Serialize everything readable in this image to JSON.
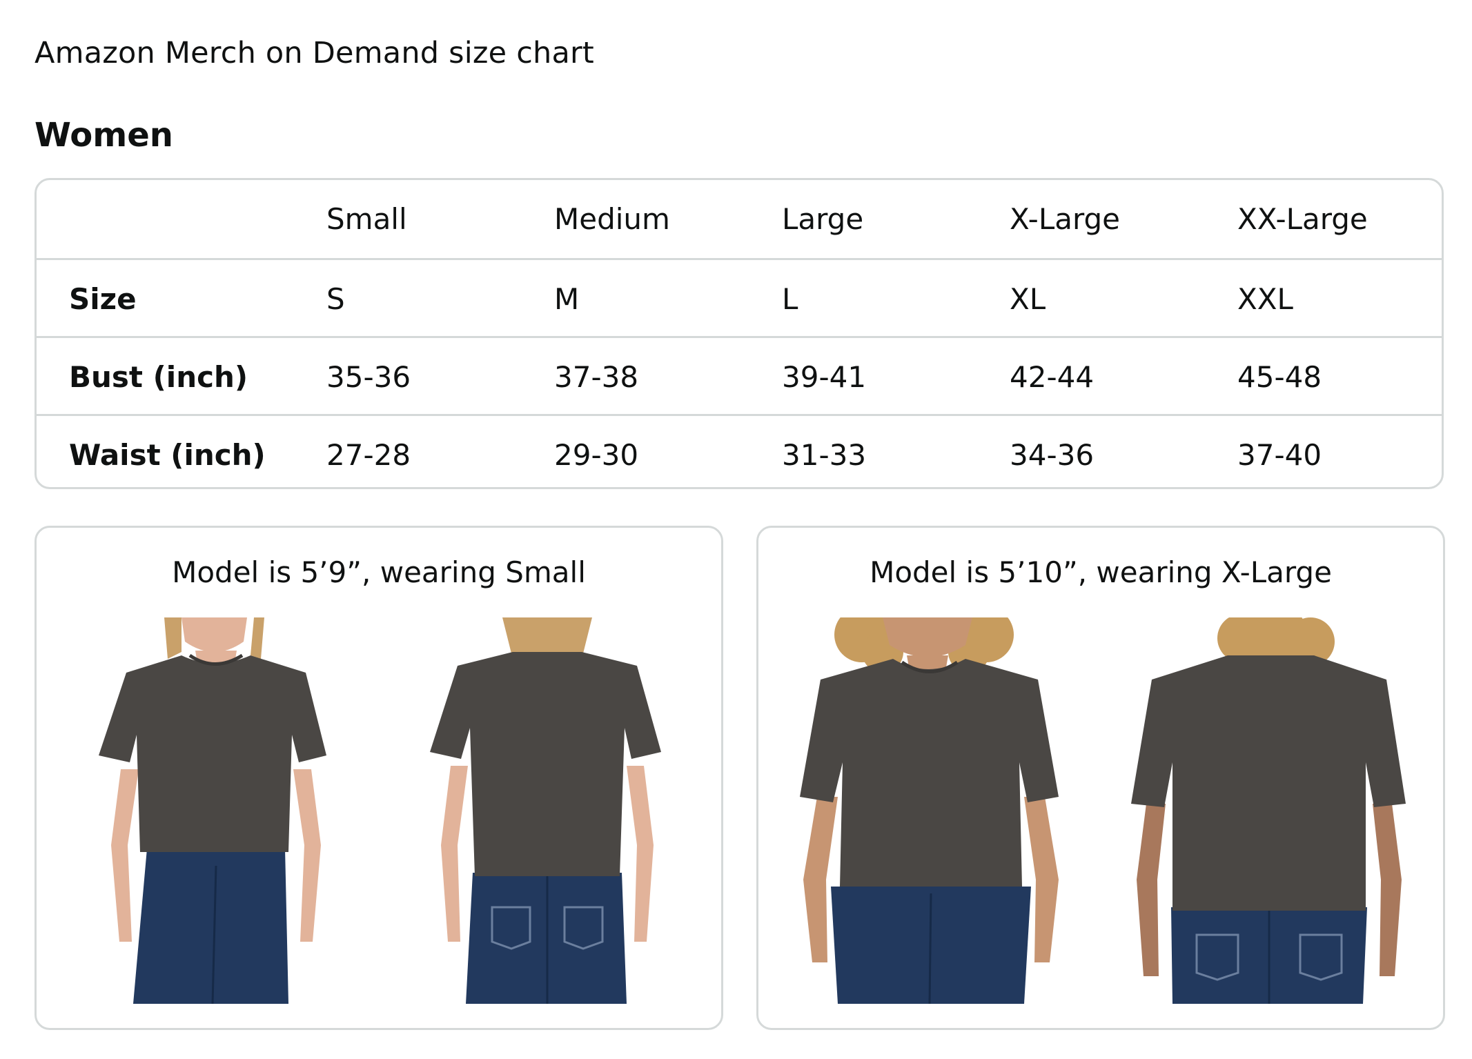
{
  "page": {
    "title": "Amazon Merch on Demand size chart",
    "section": "Women"
  },
  "size_table": {
    "columns": [
      "",
      "Small",
      "Medium",
      "Large",
      "X-Large",
      "XX-Large"
    ],
    "rows": [
      {
        "label": "Size",
        "values": [
          "S",
          "M",
          "L",
          "XL",
          "XXL"
        ]
      },
      {
        "label": "Bust (inch)",
        "values": [
          "35-36",
          "37-38",
          "39-41",
          "42-44",
          "45-48"
        ]
      },
      {
        "label": "Waist (inch)",
        "values": [
          "27-28",
          "29-30",
          "31-33",
          "34-36",
          "37-40"
        ]
      }
    ]
  },
  "models": [
    {
      "caption": "Model is 5’9”, wearing Small"
    },
    {
      "caption": "Model is 5’10”, wearing X-Large"
    }
  ],
  "colors": {
    "border": "#d5d9d9",
    "text": "#0f1111",
    "tshirt": "#4a4744",
    "denim": "#22395e",
    "skin": "#e2b39a",
    "hair_blonde": "#c9a16a",
    "hair_curly": "#c79c5e"
  }
}
